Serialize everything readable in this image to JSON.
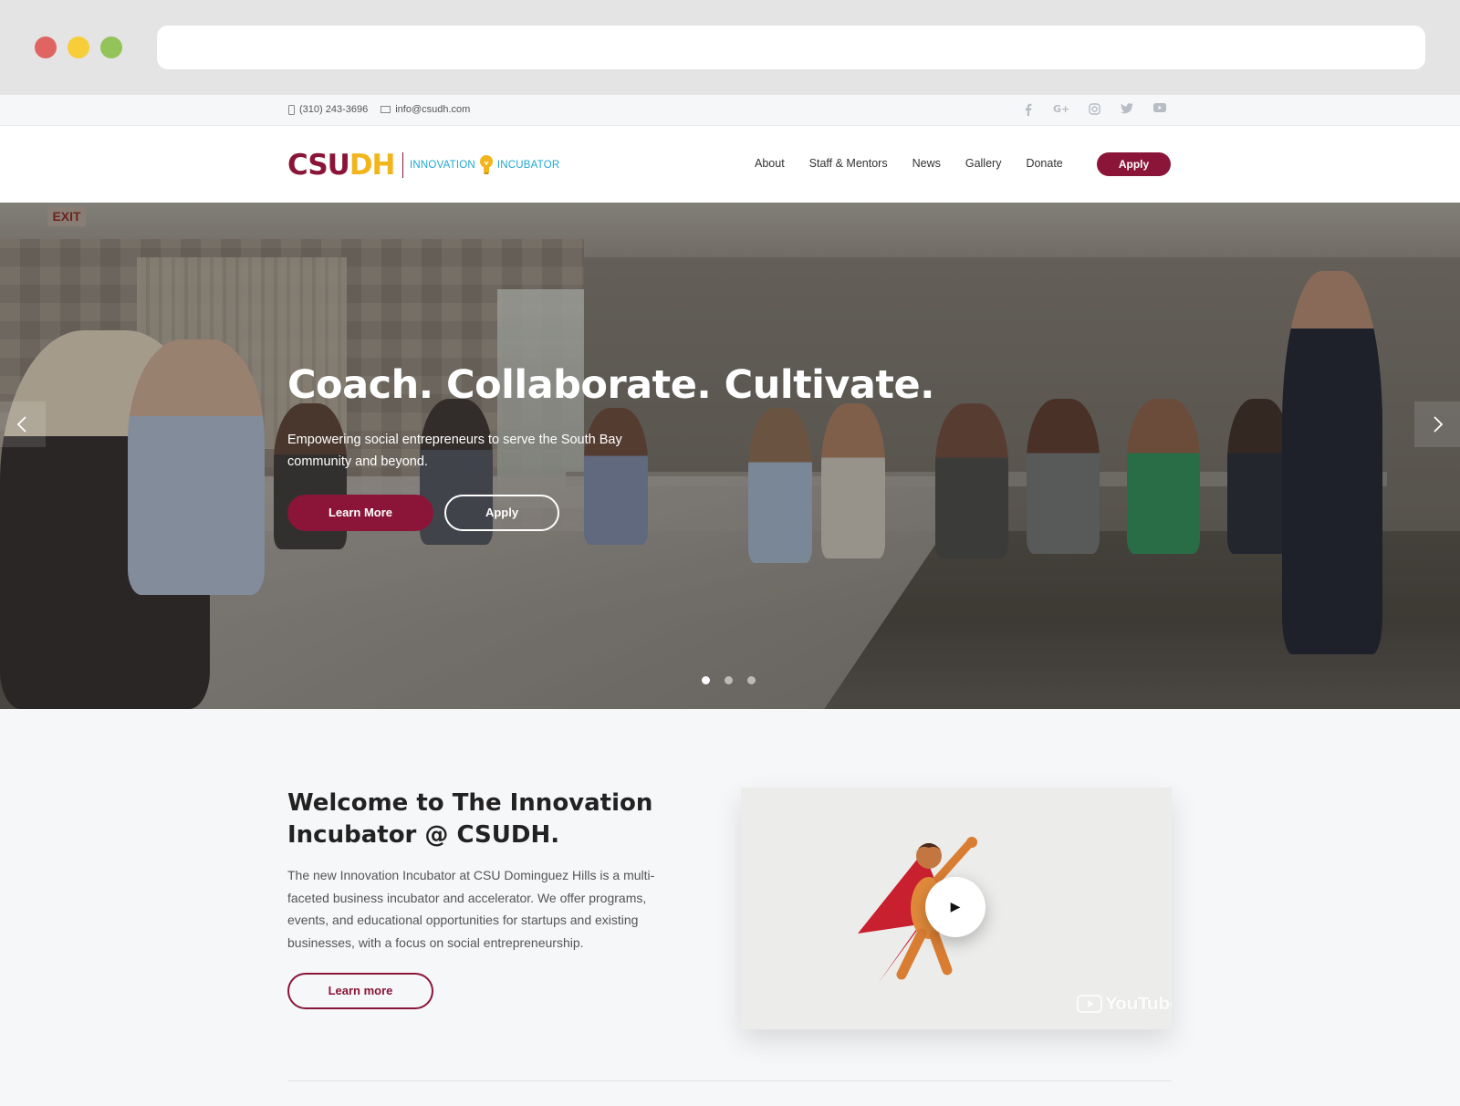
{
  "topbar": {
    "phone": "(310) 243-3696",
    "email": "info@csudh.com",
    "socials": [
      "facebook-icon",
      "google-plus-icon",
      "instagram-icon",
      "twitter-icon",
      "youtube-icon"
    ]
  },
  "logo": {
    "csu": "CSU",
    "dh": "DH",
    "innovation": "INNOVATION",
    "incubator": "INCUBATOR"
  },
  "nav": {
    "items": [
      "About",
      "Staff & Mentors",
      "News",
      "Gallery",
      "Donate"
    ],
    "apply": "Apply"
  },
  "hero": {
    "title": "Coach. Collaborate. Cultivate.",
    "subtitle": "Empowering social entrepreneurs to serve the South Bay community and beyond.",
    "learn_more": "Learn More",
    "apply": "Apply",
    "exit_sign": "EXIT",
    "slide_count": 3,
    "active_slide": 1
  },
  "welcome": {
    "title": "Welcome to The Innovation Incubator @ CSUDH.",
    "body": "The new Innovation Incubator at CSU Dominguez Hills is a multi-faceted business incubator and accelerator. We offer programs, events, and educational opportunities for startups and existing businesses, with a focus on social entrepreneurship.",
    "learn_more": "Learn more",
    "video_brand": "YouTube"
  },
  "colors": {
    "brand_maroon": "#8a1538",
    "brand_gold": "#f2b51c",
    "accent_cyan": "#1ea8d0"
  }
}
